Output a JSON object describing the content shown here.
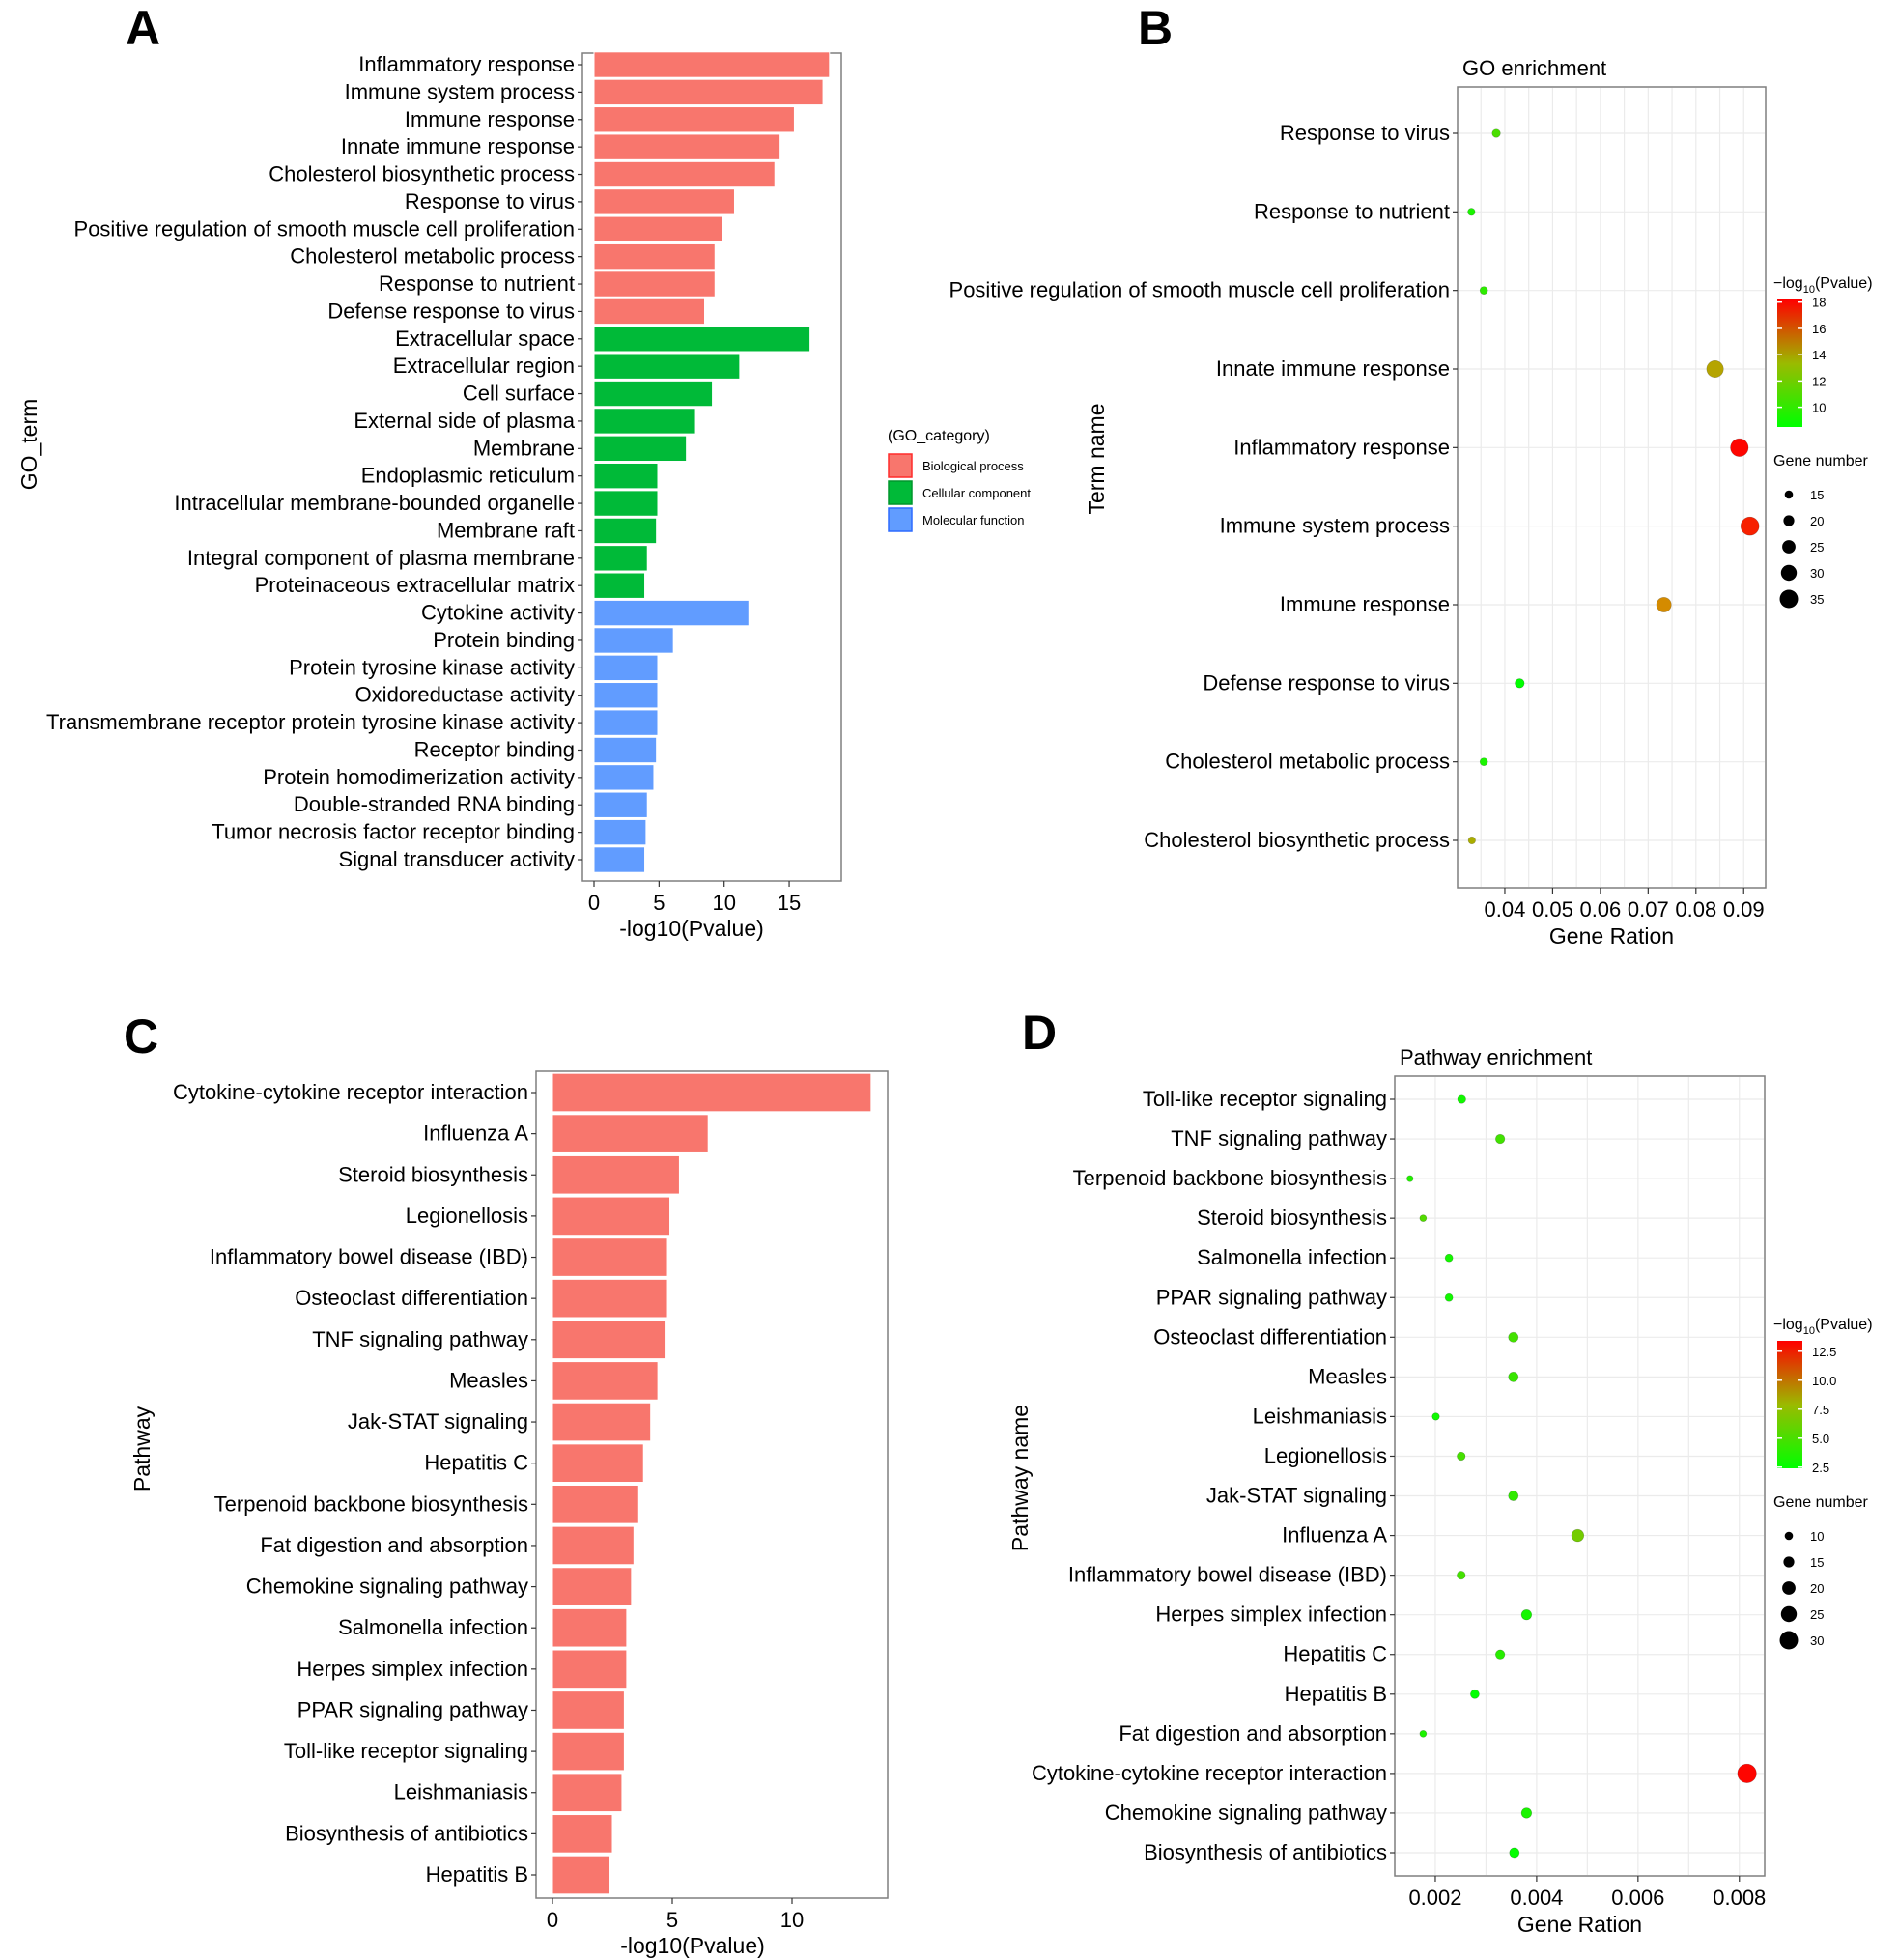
{
  "panels": {
    "A": "A",
    "B": "B",
    "C": "C",
    "D": "D"
  },
  "chart_data": [
    {
      "id": "A",
      "type": "bar",
      "orientation": "horizontal",
      "title": "",
      "xlabel": "-log10(Pvalue)",
      "ylabel": "GO_term",
      "xlim": [
        0,
        19
      ],
      "xticks": [
        0,
        5,
        10,
        15
      ],
      "grid": false,
      "legend": {
        "title": "(GO_category)",
        "position": "right",
        "entries": [
          {
            "name": "Biological process",
            "color": "#F8766D"
          },
          {
            "name": "Cellular component",
            "color": "#00BA38"
          },
          {
            "name": "Molecular function",
            "color": "#619CFF"
          }
        ]
      },
      "categories": [
        "Inflammatory response",
        "Immune system process",
        "Immune response",
        "Innate immune response",
        "Cholesterol biosynthetic process",
        "Response to virus",
        "Positive regulation of smooth muscle cell proliferation",
        "Cholesterol metabolic process",
        "Response to nutrient",
        "Defense response to virus",
        "Extracellular space",
        "Extracellular region",
        "Cell surface",
        "External side of plasma",
        "Membrane",
        "Endoplasmic reticulum",
        "Intracellular membrane-bounded organelle",
        "Membrane raft",
        "Integral component of plasma membrane",
        "Proteinaceous extracellular matrix",
        "Cytokine activity",
        "Protein binding",
        "Protein tyrosine kinase activity",
        "Oxidoreductase activity",
        "Transmembrane receptor protein tyrosine kinase activity",
        "Receptor binding",
        "Protein homodimerization activity",
        "Double-stranded RNA binding",
        "Tumor necrosis factor receptor binding",
        "Signal transducer activity"
      ],
      "values": [
        18.1,
        17.6,
        15.4,
        14.3,
        13.9,
        10.8,
        9.9,
        9.3,
        9.3,
        8.5,
        16.6,
        11.2,
        9.1,
        7.8,
        7.1,
        4.9,
        4.9,
        4.8,
        4.1,
        3.9,
        11.9,
        6.1,
        4.9,
        4.9,
        4.9,
        4.8,
        4.6,
        4.1,
        4.0,
        3.9
      ],
      "groups": [
        "Biological process",
        "Biological process",
        "Biological process",
        "Biological process",
        "Biological process",
        "Biological process",
        "Biological process",
        "Biological process",
        "Biological process",
        "Biological process",
        "Cellular component",
        "Cellular component",
        "Cellular component",
        "Cellular component",
        "Cellular component",
        "Cellular component",
        "Cellular component",
        "Cellular component",
        "Cellular component",
        "Cellular component",
        "Molecular function",
        "Molecular function",
        "Molecular function",
        "Molecular function",
        "Molecular function",
        "Molecular function",
        "Molecular function",
        "Molecular function",
        "Molecular function",
        "Molecular function"
      ]
    },
    {
      "id": "B",
      "type": "scatter",
      "title": "GO enrichment",
      "xlabel": "Gene Ration",
      "ylabel": "Term name",
      "xlim": [
        0.0301,
        0.0946
      ],
      "xticks": [
        0.04,
        0.05,
        0.06,
        0.07,
        0.08,
        0.09
      ],
      "xtick_labels": [
        "0.04",
        "0.05",
        "0.06",
        "0.07",
        "0.08",
        "0.09"
      ],
      "grid": true,
      "categories": [
        "Response to virus",
        "Response to nutrient",
        "Positive regulation of smooth muscle cell proliferation",
        "Innate immune response",
        "Inflammatory response",
        "Immune system process",
        "Immune response",
        "Defense response to virus",
        "Cholesterol metabolic process",
        "Cholesterol biosynthetic process"
      ],
      "x": [
        0.0382,
        0.033,
        0.0356,
        0.084,
        0.0891,
        0.0913,
        0.0733,
        0.0431,
        0.0356,
        0.0331
      ],
      "neg_log10_pvalue": [
        10.8,
        9.3,
        9.9,
        14.3,
        18.1,
        17.6,
        15.4,
        8.5,
        9.3,
        13.9
      ],
      "gene_number": [
        15,
        13,
        14,
        32,
        34,
        35,
        28,
        17,
        14,
        13
      ],
      "color_legend": {
        "title_prefix": "−log",
        "title_sub": "10",
        "title_suffix": "(Pvalue)",
        "range": [
          8.5,
          18.2
        ],
        "ticks": [
          18,
          16,
          14,
          12,
          10
        ],
        "low_color": "#00FF00",
        "high_color": "#FF0000"
      },
      "size_legend": {
        "title": "Gene number",
        "values": [
          15,
          20,
          25,
          30,
          35
        ]
      },
      "legend_position": "right"
    },
    {
      "id": "C",
      "type": "bar",
      "orientation": "horizontal",
      "title": "",
      "xlabel": "-log10(Pvalue)",
      "ylabel": "Pathway",
      "xlim": [
        0,
        14
      ],
      "xticks": [
        0,
        5,
        10
      ],
      "grid": false,
      "bar_color": "#F8766D",
      "categories": [
        "Cytokine-cytokine receptor interaction",
        "Influenza A",
        "Steroid biosynthesis",
        "Legionellosis",
        "Inflammatory bowel disease (IBD)",
        "Osteoclast differentiation",
        "TNF signaling pathway",
        "Measles",
        "Jak-STAT signaling",
        "Hepatitis C",
        "Terpenoid backbone biosynthesis",
        "Fat digestion and absorption",
        "Chemokine signaling pathway",
        "Salmonella infection",
        "Herpes simplex infection",
        "PPAR signaling pathway",
        "Toll-like receptor signaling",
        "Leishmaniasis",
        "Biosynthesis of antibiotics",
        "Hepatitis B"
      ],
      "values": [
        13.3,
        6.5,
        5.3,
        4.9,
        4.8,
        4.8,
        4.7,
        4.4,
        4.1,
        3.8,
        3.6,
        3.4,
        3.3,
        3.1,
        3.1,
        3.0,
        3.0,
        2.9,
        2.5,
        2.4
      ]
    },
    {
      "id": "D",
      "type": "scatter",
      "title": "Pathway enrichment",
      "xlabel": "Gene Ration",
      "ylabel": "Pathway name",
      "xlim": [
        0.0012,
        0.0085
      ],
      "xticks": [
        0.002,
        0.004,
        0.006,
        0.008
      ],
      "xtick_labels": [
        "0.002",
        "0.004",
        "0.006",
        "0.008"
      ],
      "grid": true,
      "categories": [
        "Toll-like receptor signaling",
        "TNF signaling pathway",
        "Terpenoid backbone biosynthesis",
        "Steroid biosynthesis",
        "Salmonella infection",
        "PPAR signaling pathway",
        "Osteoclast differentiation",
        "Measles",
        "Leishmaniasis",
        "Legionellosis",
        "Jak-STAT signaling",
        "Influenza A",
        "Inflammatory bowel disease (IBD)",
        "Herpes simplex infection",
        "Hepatitis C",
        "Hepatitis B",
        "Fat digestion and absorption",
        "Cytokine-cytokine receptor interaction",
        "Chemokine signaling pathway",
        "Biosynthesis of antibiotics"
      ],
      "x": [
        0.00252,
        0.00328,
        0.0015,
        0.00176,
        0.00227,
        0.00227,
        0.00354,
        0.00354,
        0.00201,
        0.00251,
        0.00354,
        0.00481,
        0.00251,
        0.0038,
        0.00328,
        0.00278,
        0.00176,
        0.00815,
        0.0038,
        0.00356
      ],
      "neg_log10_pvalue": [
        3.0,
        4.7,
        3.6,
        5.3,
        3.1,
        3.0,
        4.8,
        4.4,
        2.9,
        4.9,
        4.1,
        6.5,
        4.8,
        3.1,
        3.8,
        2.4,
        3.4,
        13.3,
        3.3,
        2.5
      ],
      "gene_number": [
        10,
        12,
        6,
        7,
        9,
        9,
        13,
        13,
        8,
        10,
        13,
        18,
        10,
        14,
        12,
        11,
        7,
        31,
        14,
        13
      ],
      "color_legend": {
        "title_prefix": "−log",
        "title_sub": "10",
        "title_suffix": "(Pvalue)",
        "range": [
          2.4,
          13.4
        ],
        "ticks": [
          12.5,
          10.0,
          7.5,
          5.0,
          2.5
        ],
        "tick_labels": [
          "12.5",
          "10.0",
          "7.5",
          "5.0",
          "2.5"
        ],
        "low_color": "#00FF00",
        "high_color": "#FF0000"
      },
      "size_legend": {
        "title": "Gene number",
        "values": [
          10,
          15,
          20,
          25,
          30
        ]
      },
      "legend_position": "right"
    }
  ]
}
